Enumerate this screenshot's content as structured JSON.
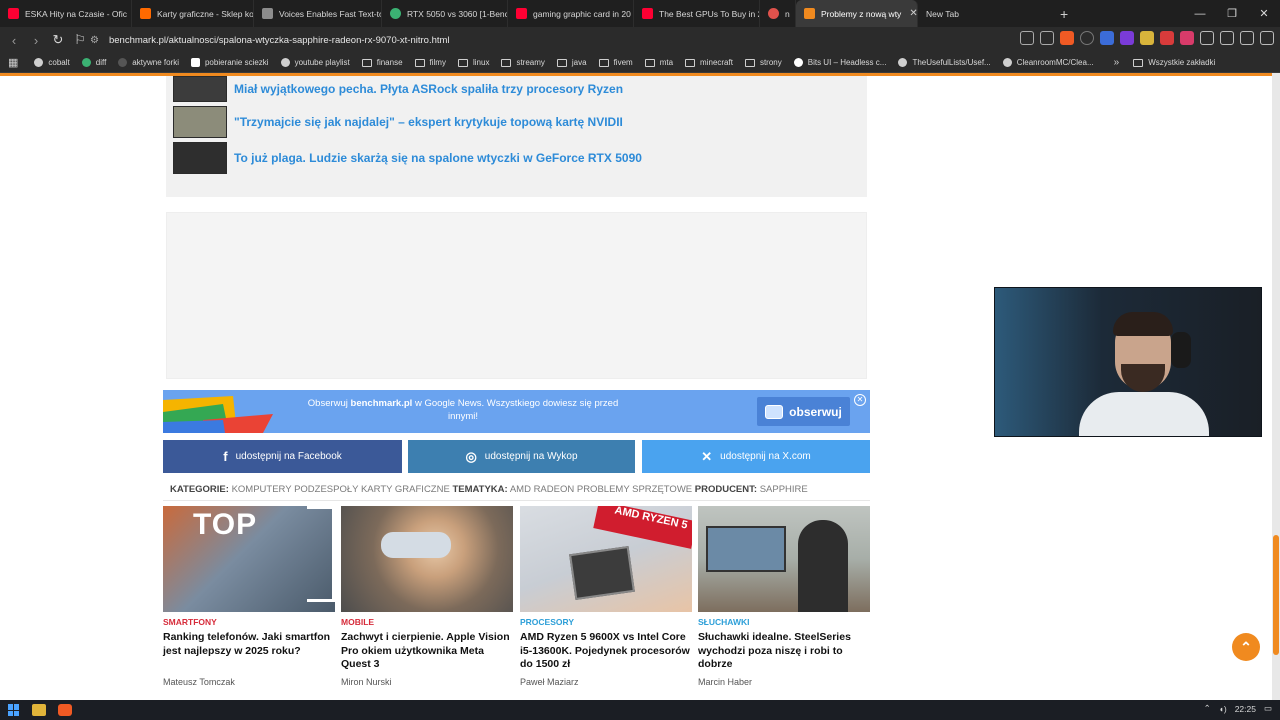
{
  "browser": {
    "tabs": [
      {
        "label": "ESKA Hity na Czasie - Ofic",
        "icon": "youtube-icon",
        "color": "#ff0033"
      },
      {
        "label": "Karty graficzne - Sklep kor",
        "icon": "store-icon",
        "color": "#ff6a00"
      },
      {
        "label": "Voices Enables Fast Text-to",
        "icon": "page-icon",
        "color": "#8c8c8c"
      },
      {
        "label": "RTX 5050 vs 3060 [1-Bench",
        "icon": "benchmark-icon",
        "color": "#3bb273"
      },
      {
        "label": "gaming graphic card in 20",
        "icon": "youtube-icon",
        "color": "#ff0033"
      },
      {
        "label": "The Best GPUs To Buy in 2",
        "icon": "youtube-icon",
        "color": "#ff0033"
      },
      {
        "label": "n",
        "icon": "search-icon",
        "color": "#e0524c"
      },
      {
        "label": "Problemy z nową wty",
        "icon": "benchmark-icon",
        "color": "#f08a1f",
        "active": true
      },
      {
        "label": "New Tab",
        "icon": "",
        "color": ""
      }
    ],
    "url": "benchmark.pl/aktualnosci/spalona-wtyczka-sapphire-radeon-rx-9070-xt-nitro.html",
    "bookmarks": [
      {
        "label": "cobalt",
        "icon": "cobalt-icon"
      },
      {
        "label": "diff",
        "icon": "diff-icon"
      },
      {
        "label": "aktywne forki",
        "icon": "page-icon"
      },
      {
        "label": "pobieranie sciezki",
        "icon": "page-icon"
      },
      {
        "label": "youtube playlist",
        "icon": "globe-icon"
      },
      {
        "label": "finanse",
        "icon": "folder-icon"
      },
      {
        "label": "filmy",
        "icon": "folder-icon"
      },
      {
        "label": "linux",
        "icon": "folder-icon"
      },
      {
        "label": "streamy",
        "icon": "folder-icon"
      },
      {
        "label": "java",
        "icon": "folder-icon"
      },
      {
        "label": "fivem",
        "icon": "folder-icon"
      },
      {
        "label": "mta",
        "icon": "folder-icon"
      },
      {
        "label": "minecraft",
        "icon": "folder-icon"
      },
      {
        "label": "strony",
        "icon": "folder-icon"
      },
      {
        "label": "Bits UI – Headless c...",
        "icon": "globe-icon"
      },
      {
        "label": "TheUsefulLists/Usef...",
        "icon": "github-icon"
      },
      {
        "label": "CleanroomMC/Clea...",
        "icon": "github-icon"
      }
    ],
    "all_bookmarks": "Wszystkie zakładki"
  },
  "related": [
    {
      "title": "Miał wyjątkowego pecha. Płyta ASRock spaliła trzy procesory Ryzen"
    },
    {
      "title": "\"Trzymajcie się jak najdalej\" – ekspert krytykuje topową kartę NVIDII"
    },
    {
      "title": "To już plaga. Ludzie skarżą się na spalone wtyczki w GeForce RTX 5090"
    }
  ],
  "gnews": {
    "text_prefix": "Obserwuj ",
    "text_brand": "benchmark.pl",
    "text_suffix": " w Google News. Wszystkiego dowiesz się przed innymi!",
    "button": "obserwuj"
  },
  "share": {
    "facebook": "udostępnij na Facebook",
    "wykop": "udostępnij na Wykop",
    "x": "udostępnij na X.com"
  },
  "categories": {
    "kategorie_label": "KATEGORIE:",
    "kategorie": [
      "KOMPUTERY",
      "PODZESPOŁY",
      "KARTY GRAFICZNE"
    ],
    "tematyka_label": "TEMATYKA:",
    "tematyka": [
      "AMD RADEON",
      "PROBLEMY SPRZĘTOWE"
    ],
    "producent_label": "PRODUCENT:",
    "producent": [
      "SAPPHIRE"
    ]
  },
  "cards": [
    {
      "category": "SMARTFONY",
      "cat_color": "#d62b3a",
      "title": "Ranking telefonów. Jaki smartfon jest najlepszy w 2025 roku?",
      "author": "Mateusz Tomczak",
      "img_text": "TOP"
    },
    {
      "category": "MOBILE",
      "cat_color": "#d62b3a",
      "title": "Zachwyt i cierpienie. Apple Vision Pro okiem użytkownika Meta Quest 3",
      "author": "Miron Nurski",
      "img_text": ""
    },
    {
      "category": "PROCESORY",
      "cat_color": "#2d9fd8",
      "title": "AMD Ryzen 5 9600X vs Intel Core i5-13600K. Pojedynek procesorów do 1500 zł",
      "author": "Paweł Maziarz",
      "img_text": "AMD RYZEN 5"
    },
    {
      "category": "SŁUCHAWKI",
      "cat_color": "#2d9fd8",
      "title": "Słuchawki idealne. SteelSeries wychodzi poza niszę i robi to dobrze",
      "author": "Marcin Haber",
      "img_text": ""
    }
  ],
  "taskbar": {
    "clock": "22:25"
  }
}
